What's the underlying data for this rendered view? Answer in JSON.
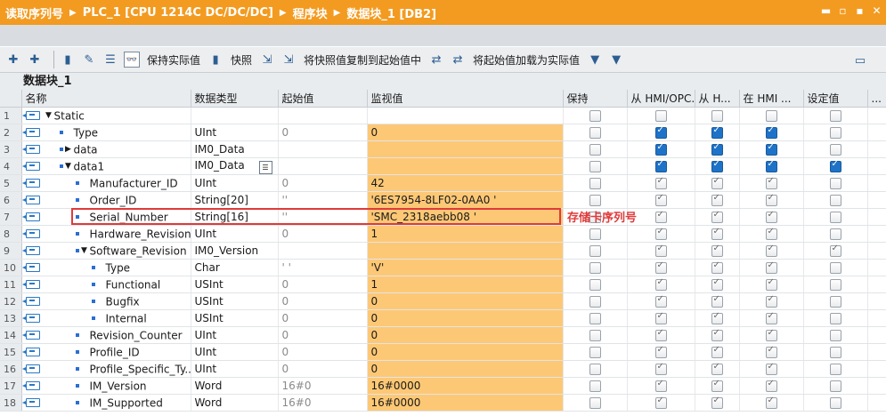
{
  "breadcrumb": [
    "读取序列号",
    "PLC_1 [CPU 1214C DC/DC/DC]",
    "程序块",
    "数据块_1 [DB2]"
  ],
  "window_controls": [
    "▬",
    "▫",
    "▪",
    "✕"
  ],
  "toolbar": {
    "keep_actual_label": "保持实际值",
    "snapshot_label": "快照",
    "copy_snapshot_label": "将快照值复制到起始值中",
    "load_start_label": "将起始值加载为实际值"
  },
  "block_name": "数据块_1",
  "columns": [
    "",
    "名称",
    "数据类型",
    "起始值",
    "监视值",
    "保持",
    "从 HMI/OPC...",
    "从 H...",
    "在 HMI ...",
    "设定值",
    "..."
  ],
  "rows": [
    {
      "num": "1",
      "indent": 0,
      "expand": "▼",
      "sq": false,
      "name": "Static",
      "type": "",
      "start": "",
      "monitor": "",
      "retain": "off",
      "c1": "off",
      "c2": "off",
      "c3": "off",
      "set": "off"
    },
    {
      "num": "2",
      "indent": 1,
      "expand": "",
      "sq": true,
      "name": "Type",
      "type": "UInt",
      "start": "0",
      "monitor": "0",
      "retain": "off",
      "c1": "on",
      "c2": "on",
      "c3": "on",
      "set": "off"
    },
    {
      "num": "3",
      "indent": 1,
      "expand": "▶",
      "sq": true,
      "name": "data",
      "type": "IM0_Data",
      "start": "",
      "monitor": "",
      "retain": "off",
      "c1": "on",
      "c2": "on",
      "c3": "on",
      "set": "off"
    },
    {
      "num": "4",
      "indent": 1,
      "expand": "▼",
      "sq": true,
      "name": "data1",
      "type": "IM0_Data",
      "start": "",
      "monitor": "",
      "retain": "off",
      "c1": "on",
      "c2": "on",
      "c3": "on",
      "set": "on"
    },
    {
      "num": "5",
      "indent": 2,
      "expand": "",
      "sq": true,
      "name": "Manufacturer_ID",
      "type": "UInt",
      "start": "0",
      "monitor": "42",
      "retain": "off",
      "c1": "gchk",
      "c2": "gchk",
      "c3": "gchk",
      "set": "off"
    },
    {
      "num": "6",
      "indent": 2,
      "expand": "",
      "sq": true,
      "name": "Order_ID",
      "type": "String[20]",
      "start": "''",
      "monitor": "'6ES7954-8LF02-0AA0 '",
      "retain": "off",
      "c1": "gchk",
      "c2": "gchk",
      "c3": "gchk",
      "set": "off"
    },
    {
      "num": "7",
      "indent": 2,
      "expand": "",
      "sq": true,
      "name": "Serial_Number",
      "type": "String[16]",
      "start": "''",
      "monitor": "'SMC_2318aebb08 '",
      "retain": "off",
      "c1": "gchk",
      "c2": "gchk",
      "c3": "gchk",
      "set": "off"
    },
    {
      "num": "8",
      "indent": 2,
      "expand": "",
      "sq": true,
      "name": "Hardware_Revision",
      "type": "UInt",
      "start": "0",
      "monitor": "1",
      "retain": "off",
      "c1": "gchk",
      "c2": "gchk",
      "c3": "gchk",
      "set": "off"
    },
    {
      "num": "9",
      "indent": 2,
      "expand": "▼",
      "sq": true,
      "name": "Software_Revision",
      "type": "IM0_Version",
      "start": "",
      "monitor": "",
      "retain": "off",
      "c1": "gchk",
      "c2": "gchk",
      "c3": "gchk",
      "set": "gchk"
    },
    {
      "num": "10",
      "indent": 3,
      "expand": "",
      "sq": true,
      "name": "Type",
      "type": "Char",
      "start": "' '",
      "monitor": "'V'",
      "retain": "off",
      "c1": "gchk",
      "c2": "gchk",
      "c3": "gchk",
      "set": "off"
    },
    {
      "num": "11",
      "indent": 3,
      "expand": "",
      "sq": true,
      "name": "Functional",
      "type": "USInt",
      "start": "0",
      "monitor": "1",
      "retain": "off",
      "c1": "gchk",
      "c2": "gchk",
      "c3": "gchk",
      "set": "off"
    },
    {
      "num": "12",
      "indent": 3,
      "expand": "",
      "sq": true,
      "name": "Bugfix",
      "type": "USInt",
      "start": "0",
      "monitor": "0",
      "retain": "off",
      "c1": "gchk",
      "c2": "gchk",
      "c3": "gchk",
      "set": "off"
    },
    {
      "num": "13",
      "indent": 3,
      "expand": "",
      "sq": true,
      "name": "Internal",
      "type": "USInt",
      "start": "0",
      "monitor": "0",
      "retain": "off",
      "c1": "gchk",
      "c2": "gchk",
      "c3": "gchk",
      "set": "off"
    },
    {
      "num": "14",
      "indent": 2,
      "expand": "",
      "sq": true,
      "name": "Revision_Counter",
      "type": "UInt",
      "start": "0",
      "monitor": "0",
      "retain": "off",
      "c1": "gchk",
      "c2": "gchk",
      "c3": "gchk",
      "set": "off"
    },
    {
      "num": "15",
      "indent": 2,
      "expand": "",
      "sq": true,
      "name": "Profile_ID",
      "type": "UInt",
      "start": "0",
      "monitor": "0",
      "retain": "off",
      "c1": "gchk",
      "c2": "gchk",
      "c3": "gchk",
      "set": "off"
    },
    {
      "num": "16",
      "indent": 2,
      "expand": "",
      "sq": true,
      "name": "Profile_Specific_Ty...",
      "type": "UInt",
      "start": "0",
      "monitor": "0",
      "retain": "off",
      "c1": "gchk",
      "c2": "gchk",
      "c3": "gchk",
      "set": "off"
    },
    {
      "num": "17",
      "indent": 2,
      "expand": "",
      "sq": true,
      "name": "IM_Version",
      "type": "Word",
      "start": "16#0",
      "monitor": "16#0000",
      "retain": "off",
      "c1": "gchk",
      "c2": "gchk",
      "c3": "gchk",
      "set": "off"
    },
    {
      "num": "18",
      "indent": 2,
      "expand": "",
      "sq": true,
      "name": "IM_Supported",
      "type": "Word",
      "start": "16#0",
      "monitor": "16#0000",
      "retain": "off",
      "c1": "gchk",
      "c2": "gchk",
      "c3": "gchk",
      "set": "off"
    }
  ],
  "annotation": "存储卡序列号",
  "colors": {
    "title_bar": "#f39b20",
    "monitor_cell": "#fdc875",
    "highlight": "#e03a3a",
    "checked": "#1e73c8"
  }
}
